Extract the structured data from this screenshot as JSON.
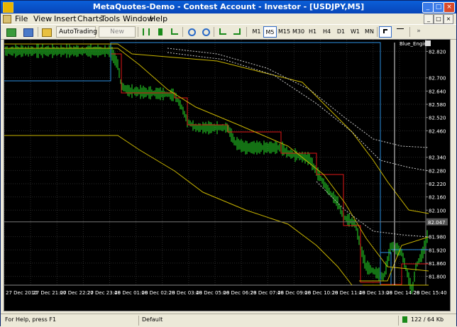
{
  "window": {
    "title": "MetaQuotes-Demo - Contest Account - Investor - [USDJPY,M5]",
    "controls": [
      "_",
      "□",
      "×"
    ]
  },
  "menu": {
    "items": [
      "File",
      "View",
      "Insert",
      "Charts",
      "Tools",
      "Window",
      "Help"
    ],
    "doc_controls": [
      "_",
      "□",
      "×"
    ]
  },
  "toolbar": {
    "autotrading": "AutoTrading",
    "new_order": "New Order",
    "timeframes": [
      "M1",
      "M5",
      "M15",
      "M30",
      "H1",
      "H4",
      "D1",
      "W1",
      "MN"
    ],
    "active_timeframe": "M5"
  },
  "chart": {
    "symbol": "USDJPY",
    "indicator_label": "Blue_Engine",
    "price_labels": [
      "82.820",
      "82.700",
      "82.640",
      "82.580",
      "82.520",
      "82.460",
      "82.340",
      "82.280",
      "82.220",
      "82.160",
      "82.100",
      "82.047",
      "81.980",
      "81.920",
      "81.860",
      "81.800"
    ],
    "current_price": "82.047",
    "time_labels": [
      "27 Dec 2010",
      "27 Dec 21:00",
      "27 Dec 22:20",
      "27 Dec 23:40",
      "28 Dec 01:00",
      "28 Dec 02:20",
      "28 Dec 03:40",
      "28 Dec 05:00",
      "28 Dec 06:20",
      "28 Dec 07:40",
      "28 Dec 09:00",
      "28 Dec 10:20",
      "28 Dec 11:40",
      "28 Dec 13:00",
      "28 Dec 14:20",
      "28 Dec 15:40"
    ],
    "colors": {
      "background": "#000000",
      "grid": "#2a2a2a",
      "candles": "#1fae1f",
      "bands": "#c8b400",
      "red_line": "#e01818",
      "blue_line": "#2b8fe0",
      "dotted": "#c8c8c8",
      "text": "#ffffff"
    }
  },
  "status": {
    "help": "For Help, press F1",
    "profile": "Default",
    "connection": "122 / 64 Kb"
  }
}
